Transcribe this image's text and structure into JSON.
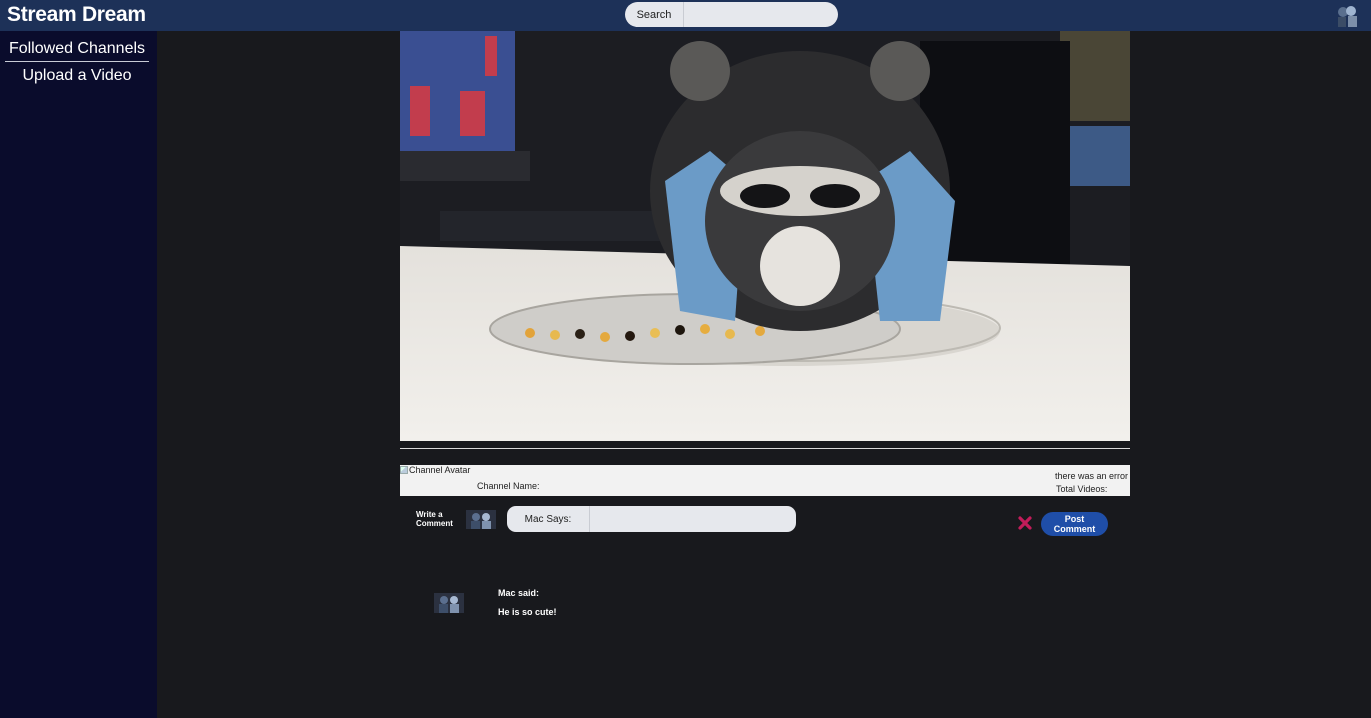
{
  "header": {
    "logo": "Stream Dream",
    "search_label": "Search",
    "search_value": ""
  },
  "sidebar": {
    "items": [
      {
        "label": "Followed Channels"
      },
      {
        "label": "Upload a Video"
      }
    ]
  },
  "channel": {
    "avatar_alt": "Channel Avatar",
    "name_label": "Channel Name:",
    "error_text": "there was an error",
    "total_videos_label": "Total Videos:"
  },
  "comment_form": {
    "write_label": "Write a Comment",
    "says_label": "Mac Says:",
    "input_value": "",
    "post_label": "Post Comment",
    "cancel_icon": "close-icon",
    "cancel_color": "#c21c5a"
  },
  "comments": [
    {
      "author": "Mac said:",
      "text": "He is so cute!"
    }
  ],
  "colors": {
    "topbar": "#1d3158",
    "sidebar": "#0a0c2c",
    "background": "#18191d",
    "post_button": "#1f4ea8"
  }
}
